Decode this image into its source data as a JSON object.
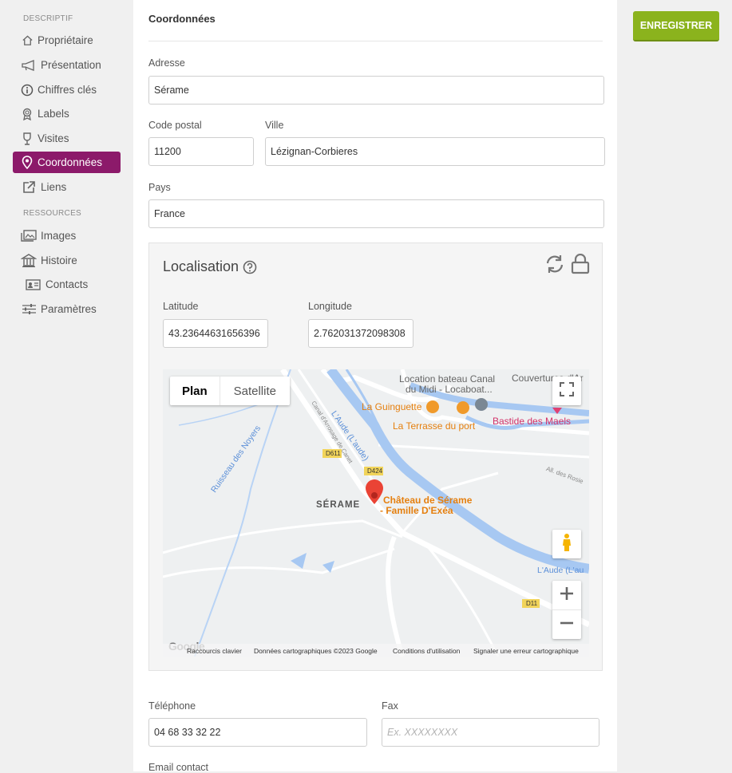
{
  "sidebar": {
    "section_descriptif": "DESCRIPTIF",
    "section_ressources": "RESSOURCES",
    "items": [
      {
        "label": "Propriétaire",
        "icon": "home-icon"
      },
      {
        "label": "Présentation",
        "icon": "megaphone-icon"
      },
      {
        "label": "Chiffres clés",
        "icon": "info-icon"
      },
      {
        "label": "Labels",
        "icon": "award-icon"
      },
      {
        "label": "Visites",
        "icon": "wine-glass-icon"
      },
      {
        "label": "Coordonnées",
        "icon": "map-pin-icon",
        "active": true
      },
      {
        "label": "Liens",
        "icon": "external-link-icon"
      },
      {
        "label": "Images",
        "icon": "images-icon"
      },
      {
        "label": "Histoire",
        "icon": "museum-icon"
      },
      {
        "label": "Contacts",
        "icon": "contact-card-icon"
      },
      {
        "label": "Paramètres",
        "icon": "sliders-icon"
      }
    ],
    "active_color": "#8c1a6a"
  },
  "form": {
    "section_title": "Coordonnées",
    "address_label": "Adresse",
    "address_value": "Sérame",
    "postal_label": "Code postal",
    "postal_value": "11200",
    "city_label": "Ville",
    "city_value": "Lézignan-Corbieres",
    "country_label": "Pays",
    "country_value": "France",
    "phone_label": "Téléphone",
    "phone_value": "04 68 33 32 22",
    "fax_label": "Fax",
    "fax_placeholder": "Ex. XXXXXXXX",
    "email_label": "Email contact"
  },
  "location": {
    "title": "Localisation",
    "latitude_label": "Latitude",
    "latitude_value": "43.23644631656396",
    "longitude_label": "Longitude",
    "longitude_value": "2.762031372098308"
  },
  "map": {
    "tab_plan": "Plan",
    "tab_satellite": "Satellite",
    "place_1": "Location bateau Canal",
    "place_1b": "du Midi - Locaboat...",
    "place_2": "Couvertures d'Ar",
    "place_3": "La Guinguette",
    "place_4": "La Terrasse du port",
    "place_5": "Bastide des Maels",
    "place_6": "Château de Sérame",
    "place_6b": "- Famille D'Exéa",
    "town": "SÉRAME",
    "road_1": "D611",
    "road_2": "D424",
    "road_3": "D11",
    "river_1": "Ruisseau des Noyers",
    "river_2": "L'Aude (L'aude)",
    "river_3": "L'Aude (L'au",
    "canal": "Canal d'Arrosage de Canet",
    "street": "All. des Rosie",
    "google": "Google",
    "footer_keys": "Raccourcis clavier",
    "footer_data": "Données cartographiques ©2023 Google",
    "footer_terms": "Conditions d'utilisation",
    "footer_report": "Signaler une erreur cartographique"
  },
  "toolbar": {
    "save_label": "ENREGISTRER",
    "save_color": "#8bb31d"
  }
}
